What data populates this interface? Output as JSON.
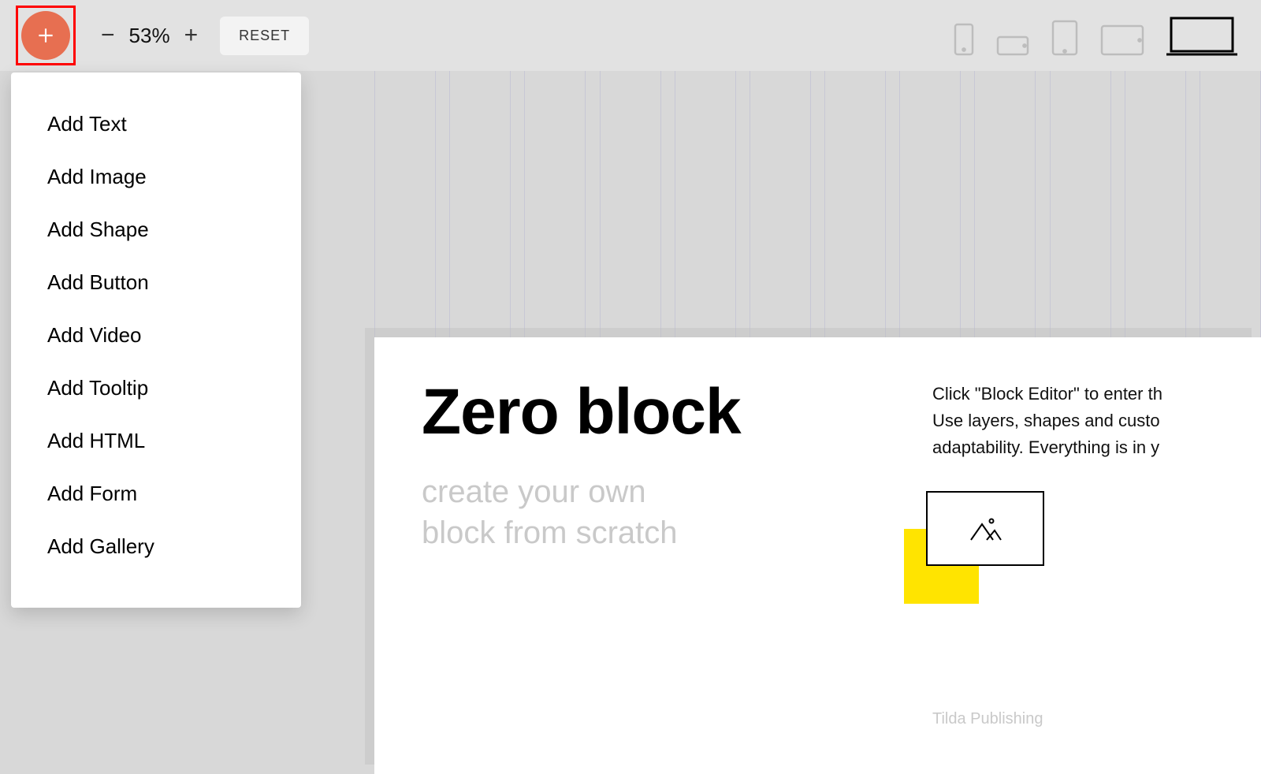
{
  "toolbar": {
    "zoom_value": "53%",
    "reset_label": "RESET"
  },
  "devices": {
    "phone_portrait": "phone-portrait",
    "phone_landscape": "phone-landscape",
    "tablet_portrait": "tablet-portrait",
    "tablet_landscape": "tablet-landscape",
    "desktop": "desktop",
    "active": "desktop"
  },
  "add_menu": {
    "items": [
      "Add Text",
      "Add Image",
      "Add Shape",
      "Add Button",
      "Add Video",
      "Add Tooltip",
      "Add HTML",
      "Add Form",
      "Add Gallery"
    ]
  },
  "canvas": {
    "title": "Zero block",
    "subtitle_line1": "create your own",
    "subtitle_line2": "block from scratch",
    "desc_line1": "Click \"Block Editor\" to enter th",
    "desc_line2": "Use layers, shapes and custo",
    "desc_line3": "adaptability. Everything is in y",
    "caption": "Tilda Publishing"
  },
  "colors": {
    "accent": "#e76f51",
    "highlight_box": "#ff0000",
    "yellow": "#ffe400"
  }
}
